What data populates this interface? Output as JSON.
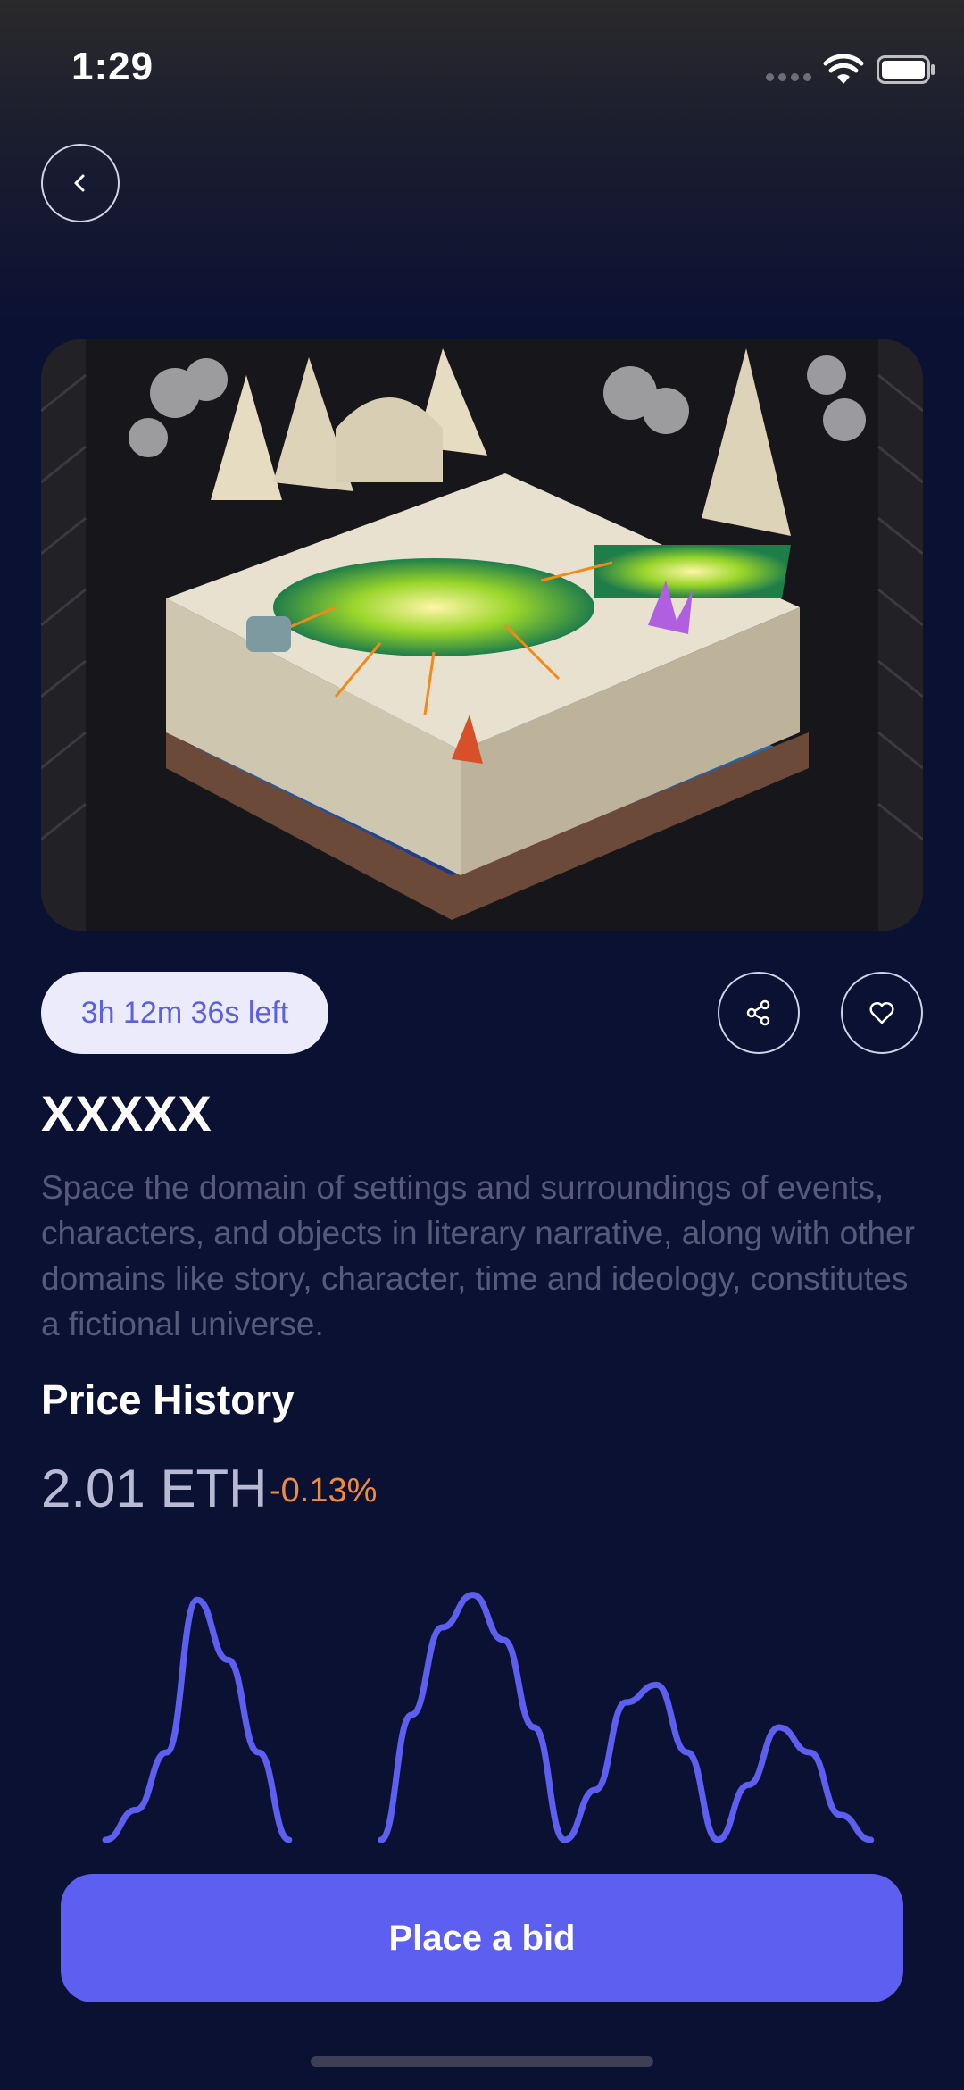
{
  "status_bar": {
    "time": "1:29"
  },
  "item": {
    "time_left": "3h 12m 36s left",
    "title": "XXXXX",
    "description": "Space the domain of settings and surroundings of events, characters, and objects in literary narrative, along with other domains like story, character, time and ideology, constitutes a fictional universe."
  },
  "price_history": {
    "title": "Price History",
    "price": "2.01 ETH",
    "change": "-0.13%"
  },
  "actions": {
    "bid_label": "Place a bid"
  },
  "icons": {
    "back": "chevron-left-icon",
    "share": "share-icon",
    "like": "heart-icon"
  },
  "colors": {
    "background": "#0b1133",
    "accent": "#5d5ff0",
    "pill": "#ecebfb",
    "negative": "#f08a3c"
  },
  "chart_data": {
    "type": "line",
    "x": [
      0,
      1,
      2,
      3,
      4,
      5,
      6,
      7,
      8,
      9,
      10,
      11,
      12,
      13,
      14,
      15,
      16,
      17,
      18,
      19,
      20,
      21,
      22,
      23,
      24,
      25,
      26
    ],
    "series": [
      {
        "values": [
          0.0,
          0.12,
          0.35,
          0.96,
          0.72,
          0.35,
          0.0,
          null,
          null,
          0.0,
          0.5,
          0.85,
          0.98,
          0.8,
          0.45,
          0.0,
          0.2,
          0.55,
          0.62,
          0.35,
          0.0,
          0.22,
          0.45,
          0.35,
          0.1,
          0.0,
          null
        ]
      }
    ],
    "title": "",
    "xlabel": "",
    "ylabel": "",
    "grid": false,
    "legend": "none"
  }
}
